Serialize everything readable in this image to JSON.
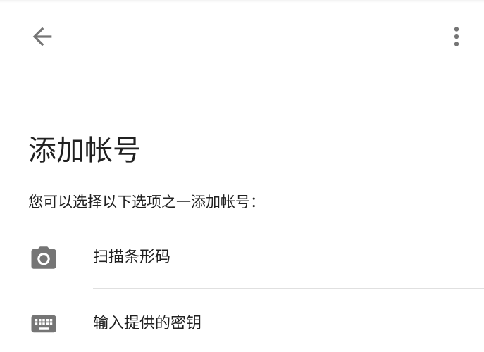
{
  "app_bar": {
    "back_icon": "arrow-left-icon",
    "more_icon": "more-vertical-icon"
  },
  "page": {
    "title": "添加帐号",
    "subtitle": "您可以选择以下选项之一添加帐号："
  },
  "options": [
    {
      "icon": "camera-icon",
      "label": "扫描条形码"
    },
    {
      "icon": "keyboard-icon",
      "label": "输入提供的密钥"
    }
  ],
  "colors": {
    "icon": "#757575",
    "text": "#212121",
    "divider": "#e0e0e0",
    "background": "#ffffff"
  }
}
